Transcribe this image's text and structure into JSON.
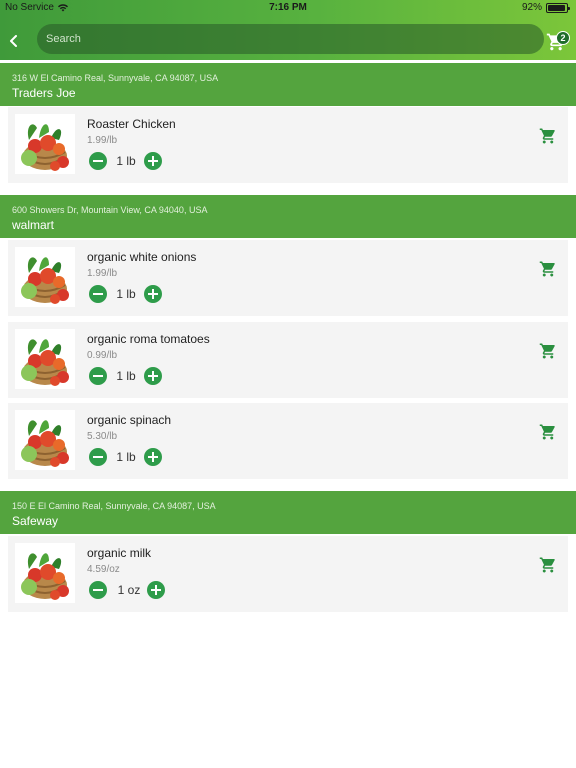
{
  "status_bar": {
    "carrier": "No Service",
    "time": "7:16 PM",
    "battery_percent": "92%",
    "battery_level": 0.92
  },
  "header": {
    "search_placeholder": "Search",
    "cart_count": "2",
    "icons": {
      "back": "chevron-left-icon",
      "cart": "shopping-cart-icon"
    }
  },
  "colors": {
    "header_gradient": [
      "#3f9a3a",
      "#7cc63a"
    ],
    "store_band": "#54a43e",
    "qty_button": "#2e9c4a",
    "cart_icon": "#2a8f3f",
    "card_background": "#f4f4f4"
  },
  "stores": [
    {
      "address": "316 W El Camino Real, Sunnyvale, CA 94087, USA",
      "name": "Traders Joe",
      "items": [
        {
          "name": "Roaster Chicken",
          "price": "1.99/lb",
          "quantity": "1 lb"
        }
      ]
    },
    {
      "address": "600 Showers Dr, Mountain View, CA 94040, USA",
      "name": "walmart",
      "items": [
        {
          "name": "organic white onions",
          "price": "1.99/lb",
          "quantity": "1 lb"
        },
        {
          "name": "organic roma tomatoes",
          "price": "0.99/lb",
          "quantity": "1 lb"
        },
        {
          "name": "organic spinach",
          "price": "5.30/lb",
          "quantity": "1 lb"
        }
      ]
    },
    {
      "address": "150 E El Camino Real, Sunnyvale, CA 94087, USA",
      "name": "Safeway",
      "items": [
        {
          "name": "organic milk",
          "price": "4.59/oz",
          "quantity": "1 oz"
        }
      ]
    }
  ]
}
